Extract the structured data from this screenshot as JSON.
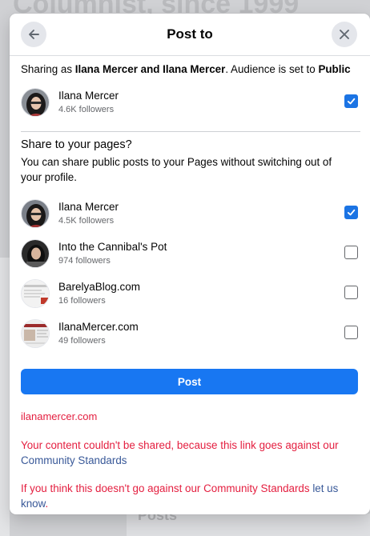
{
  "background": {
    "title": "Columnist, since 1999",
    "posts_label": "Posts"
  },
  "modal": {
    "title": "Post to",
    "sharing": {
      "prefix": "Sharing as ",
      "names": "Ilana Mercer and Ilana Mercer",
      "middle": ". Audience is set to ",
      "audience": "Public"
    },
    "profile": {
      "name": "Ilana Mercer",
      "followers": "4.6K followers",
      "checked": true
    },
    "pages_section": {
      "title": "Share to your pages?",
      "description": "You can share public posts to your Pages without switching out of your profile."
    },
    "pages": [
      {
        "name": "Ilana Mercer",
        "followers": "4.5K followers",
        "checked": true
      },
      {
        "name": "Into the Cannibal's Pot",
        "followers": "974 followers",
        "checked": false
      },
      {
        "name": "BarelyaBlog.com",
        "followers": "16 followers",
        "checked": false
      },
      {
        "name": "IlanaMercer.com",
        "followers": "49 followers",
        "checked": false
      }
    ],
    "post_button": "Post",
    "link_domain": "ilanamercer.com",
    "error": {
      "line1_red": "Your content couldn't be shared, because this link goes against our ",
      "line1_link": "Community Standards",
      "line2_red": "If you think this doesn't go against our Community Standards ",
      "line2_link": "let us know",
      "line2_end": "."
    }
  },
  "colors": {
    "accent": "#1877f2",
    "checkbox_checked": "#1b74e4",
    "error_red": "#e41e3f",
    "link_blue": "#385898"
  }
}
